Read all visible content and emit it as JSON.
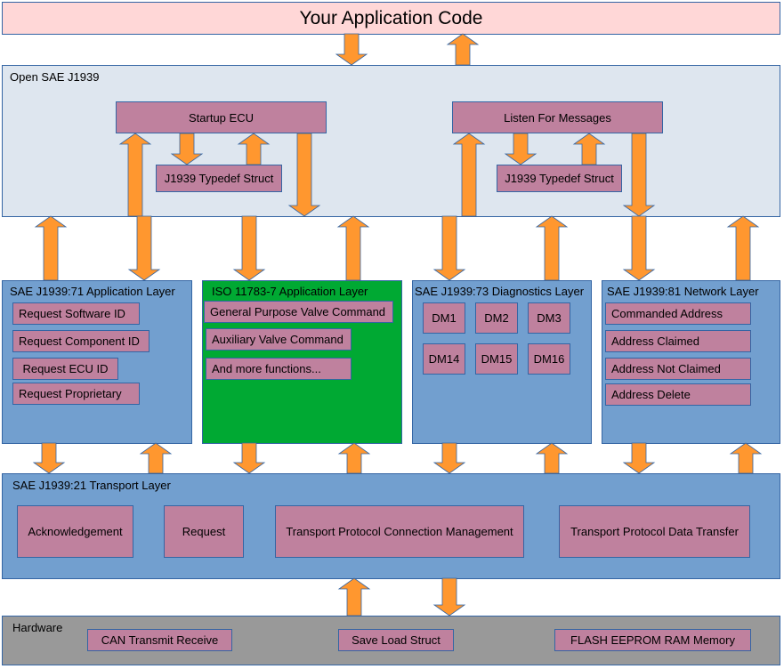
{
  "colors": {
    "app": "#ffd7d7",
    "core": "#dee6ef",
    "layer": "#729fcf",
    "item": "#bf819e",
    "iso": "#00a933",
    "hardware": "#999999",
    "arrow": "#ff972f"
  },
  "app_code": {
    "title": "Your Application Code"
  },
  "core": {
    "title": "Open SAE J1939",
    "startup": "Startup ECU",
    "listen": "Listen For Messages",
    "struct1": "J1939 Typedef Struct",
    "struct2": "J1939 Typedef Struct"
  },
  "layers": [
    {
      "title": "SAE J1939:71 Application Layer",
      "items": [
        "Request Software ID",
        "Request Component ID",
        "Request ECU ID",
        "Request Proprietary"
      ]
    },
    {
      "title": "ISO 11783-7 Application Layer",
      "items": [
        "General Purpose Valve Command",
        "Auxiliary Valve Command",
        "And more functions..."
      ]
    },
    {
      "title": "SAE J1939:73 Diagnostics Layer",
      "items": [
        "DM1",
        "DM2",
        "DM3",
        "DM14",
        "DM15",
        "DM16"
      ]
    },
    {
      "title": "SAE J1939:81 Network Layer",
      "items": [
        "Commanded Address",
        "Address Claimed",
        "Address Not Claimed",
        "Address Delete"
      ]
    }
  ],
  "transport": {
    "title": "SAE J1939:21 Transport Layer",
    "items": [
      "Acknowledgement",
      "Request",
      "Transport Protocol Connection Management",
      "Transport Protocol Data Transfer"
    ]
  },
  "hardware": {
    "title": "Hardware",
    "items": [
      "CAN Transmit Receive",
      "Save Load Struct",
      "FLASH EEPROM RAM Memory"
    ]
  }
}
